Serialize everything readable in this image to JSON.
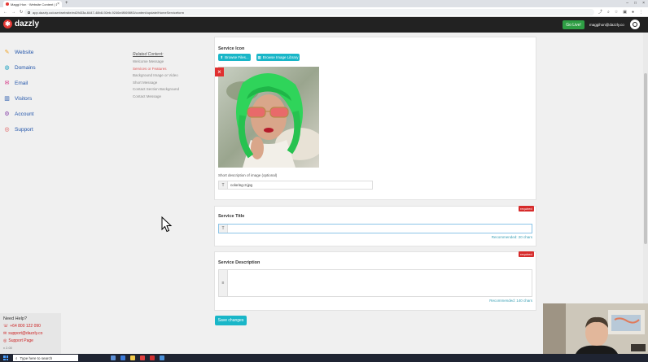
{
  "browser": {
    "tab_title": "Maggi Hon · Website Content | Dazzly",
    "tab_close": "×",
    "new_tab": "+",
    "url": "app.dazzly.co/user/website/ed2fd33a-6447-48b8-92eb-9246e4f0698f/3/content/update/HomeServiceform",
    "nav_back": "←",
    "nav_forward": "→",
    "nav_reload": "↻",
    "win_min": "–",
    "win_max": "□",
    "win_close": "×"
  },
  "header": {
    "brand": "dazzly",
    "go_live": "Go Live!",
    "user_email": "maggihon@dazzly.co"
  },
  "sidebar": {
    "items": [
      {
        "label": "Website",
        "icon": "pen-icon",
        "color": "#f0a020"
      },
      {
        "label": "Domains",
        "icon": "globe-icon",
        "color": "#1aa0c0"
      },
      {
        "label": "Email",
        "icon": "email-icon",
        "color": "#d63384"
      },
      {
        "label": "Visitors",
        "icon": "chart-icon",
        "color": "#2255aa"
      },
      {
        "label": "Account",
        "icon": "gear-icon",
        "color": "#8844aa"
      },
      {
        "label": "Support",
        "icon": "lifebuoy-icon",
        "color": "#e05555"
      }
    ],
    "help": {
      "title": "Need Help?",
      "phone": "+64 800 122 090",
      "email": "support@dazzly.co",
      "page": "Support Page",
      "version": "v 2.00"
    }
  },
  "related": {
    "heading": "Related Content:",
    "items": [
      "Welcome Message",
      "Services or Features",
      "Background Image or Video",
      "Short Message",
      "Contact Section Background",
      "Contact Message"
    ]
  },
  "form": {
    "service_icon": {
      "label": "Service Icon",
      "browse_files": "Browse Files...",
      "browse_library": "Browse Image Library",
      "remove": "×",
      "desc_label": "Short description of image (optional)",
      "desc_value": "coloring-3.jpg",
      "prefix": "T"
    },
    "service_title": {
      "required": "required",
      "label": "Service Title",
      "prefix": "T",
      "value": "",
      "hint": "Recommended: 20 chars"
    },
    "service_description": {
      "required": "required",
      "label": "Service Description",
      "prefix": "≡",
      "value": "",
      "hint": "Recommended: 140 chars"
    },
    "save": "Save changes"
  },
  "taskbar": {
    "search_placeholder": "Type here to search"
  },
  "colors": {
    "accent": "#19b6c8",
    "header_bg": "#222222",
    "go_live": "#2e9e44",
    "required": "#d62b2b",
    "brand": "#e53935"
  }
}
